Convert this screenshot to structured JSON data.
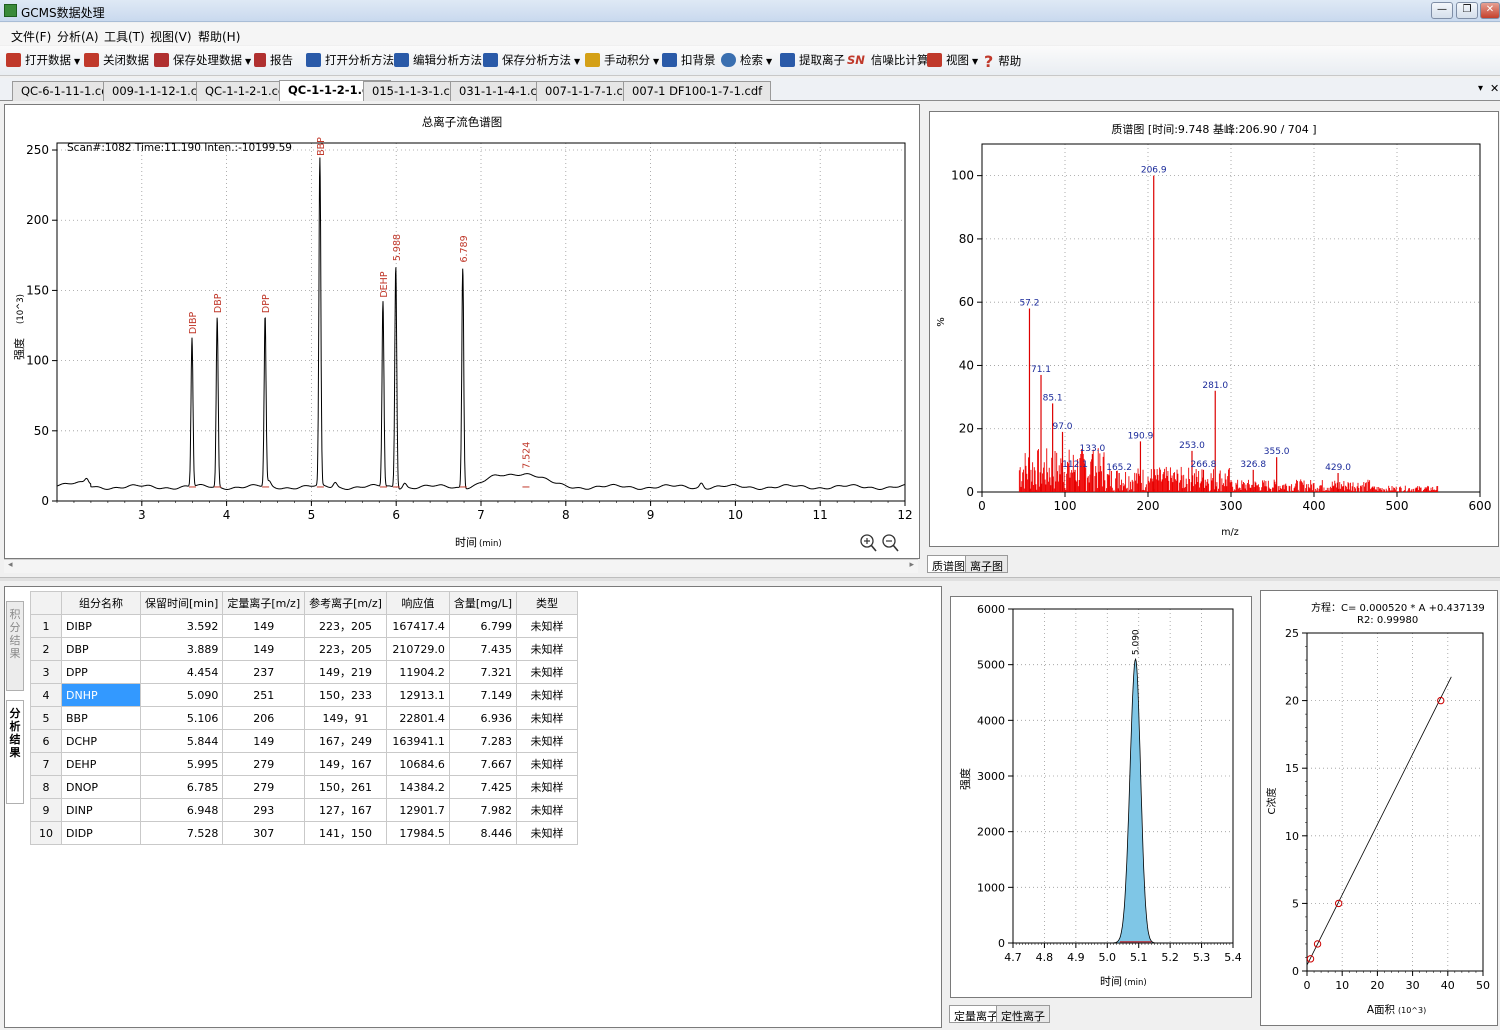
{
  "window": {
    "title": "GCMS数据处理",
    "minimize": "▭",
    "restore": "▭",
    "close": "✕"
  },
  "menu": [
    "文件(F)",
    "分析(A)",
    "工具(T)",
    "视图(V)",
    "帮助(H)"
  ],
  "toolbar": [
    {
      "label": "打开数据",
      "icon": "open-folder-icon",
      "color": "#c0392b",
      "dropdown": true
    },
    {
      "label": "关闭数据",
      "icon": "close-data-icon",
      "color": "#c0392b",
      "dropdown": false
    },
    {
      "label": "保存处理数据",
      "icon": "save-icon",
      "color": "#b03030",
      "dropdown": true
    },
    {
      "label": "报告",
      "icon": "report-icon",
      "color": "#b03030",
      "dropdown": false
    },
    {
      "label": "打开分析方法",
      "icon": "open-method-icon",
      "color": "#2a5aa8",
      "dropdown": false
    },
    {
      "label": "编辑分析方法",
      "icon": "edit-method-icon",
      "color": "#2a5aa8",
      "dropdown": false
    },
    {
      "label": "保存分析方法",
      "icon": "save-method-icon",
      "color": "#2a5aa8",
      "dropdown": true
    },
    {
      "label": "手动积分",
      "icon": "manual-integration-icon",
      "color": "#d4a017",
      "dropdown": true
    },
    {
      "label": "扣背景",
      "icon": "subtract-background-icon",
      "color": "#2a5aa8",
      "dropdown": false
    },
    {
      "label": "检索",
      "icon": "search-icon",
      "color": "#3a6fb0",
      "dropdown": true
    },
    {
      "label": "提取离子",
      "icon": "extract-ion-icon",
      "color": "#2a5aa8",
      "dropdown": false
    },
    {
      "label": "信噪比计算",
      "icon": "sn-icon",
      "color": "#c0392b",
      "dropdown": false,
      "prefix": "SN"
    },
    {
      "label": "视图",
      "icon": "view-grid-icon",
      "color": "#c0392b",
      "dropdown": true
    },
    {
      "label": "帮助",
      "icon": "help-icon",
      "color": "#c0392b",
      "dropdown": false,
      "prefix": "?"
    }
  ],
  "tabs": [
    {
      "label": "QC-6-1-11-1.cdf",
      "active": false
    },
    {
      "label": "009-1-1-12-1.cdf",
      "active": false
    },
    {
      "label": "QC-1-1-2-1.cdf",
      "active": false
    },
    {
      "label": "QC-1-1-2-1.cdf",
      "active": true
    },
    {
      "label": "015-1-1-3-1.cdf",
      "active": false
    },
    {
      "label": "031-1-1-4-1.cdf",
      "active": false
    },
    {
      "label": "007-1-1-7-1.cdf",
      "active": false
    },
    {
      "label": "007-1 DF100-1-7-1.cdf",
      "active": false
    }
  ],
  "tab_controls": {
    "dropdown": "▾",
    "close": "✕"
  },
  "tic": {
    "title": "总离子流色谱图",
    "scan_info": "Scan#:1082  Time:11.190  Inten.:-10199.59",
    "xlabel": "时间",
    "xunit": "(min)",
    "ylabel": "强度",
    "yunit": "(10^3)",
    "zoom_in": "zoom-in-icon",
    "zoom_out": "zoom-out-icon"
  },
  "mass_spectrum": {
    "title": "质谱图 [时间:9.748 基峰:206.90 / 704 ]",
    "ylabel": "%",
    "xlabel": "m/z"
  },
  "spectrum_tabs": [
    {
      "label": "质谱图",
      "active": true
    },
    {
      "label": "离子图",
      "active": false
    }
  ],
  "side_tabs": [
    {
      "label": "积分结果",
      "active": false
    },
    {
      "label": "分析结果",
      "active": true
    }
  ],
  "results_table": {
    "headers": [
      "",
      "组分名称",
      "保留时间[min]",
      "定量离子[m/z]",
      "参考离子[m/z]",
      "响应值",
      "含量[mg/L]",
      "类型"
    ],
    "rows": [
      [
        "1",
        "DIBP",
        "3.592",
        "149",
        "223，205",
        "167417.4",
        "6.799",
        "未知样"
      ],
      [
        "2",
        "DBP",
        "3.889",
        "149",
        "223，205",
        "210729.0",
        "7.435",
        "未知样"
      ],
      [
        "3",
        "DPP",
        "4.454",
        "237",
        "149，219",
        "11904.2",
        "7.321",
        "未知样"
      ],
      [
        "4",
        "DNHP",
        "5.090",
        "251",
        "150，233",
        "12913.1",
        "7.149",
        "未知样"
      ],
      [
        "5",
        "BBP",
        "5.106",
        "206",
        "149，91",
        "22801.4",
        "6.936",
        "未知样"
      ],
      [
        "6",
        "DCHP",
        "5.844",
        "149",
        "167，249",
        "163941.1",
        "7.283",
        "未知样"
      ],
      [
        "7",
        "DEHP",
        "5.995",
        "279",
        "149，167",
        "10684.6",
        "7.667",
        "未知样"
      ],
      [
        "8",
        "DNOP",
        "6.785",
        "279",
        "150，261",
        "14384.2",
        "7.425",
        "未知样"
      ],
      [
        "9",
        "DINP",
        "6.948",
        "293",
        "127，167",
        "12901.7",
        "7.982",
        "未知样"
      ],
      [
        "10",
        "DIDP",
        "7.528",
        "307",
        "141，150",
        "17984.5",
        "8.446",
        "未知样"
      ]
    ],
    "selected_row": 3
  },
  "peak_plot": {
    "ylabel": "强度",
    "xlabel": "时间",
    "xunit": "(min)"
  },
  "ion_tabs": [
    {
      "label": "定量离子",
      "active": true
    },
    {
      "label": "定性离子",
      "active": false
    }
  ],
  "calibration": {
    "equation": "方程：C= 0.000520 * A +0.437139",
    "r2": "R2:  0.99980",
    "ylabel": "C浓度",
    "xlabel": "A面积",
    "xunit": "(10^3)"
  },
  "chart_data": [
    {
      "type": "line",
      "name": "tic-chromatogram",
      "xlim": [
        2.0,
        12.0
      ],
      "ylim": [
        0,
        255
      ],
      "xticks": [
        3,
        4,
        5,
        6,
        7,
        8,
        9,
        10,
        11,
        12
      ],
      "yticks": [
        0,
        50,
        100,
        150,
        200,
        250
      ],
      "baseline": 10,
      "peaks": [
        {
          "x": 3.592,
          "y": 116,
          "label": "DIBP"
        },
        {
          "x": 3.889,
          "y": 131,
          "label": "DBP"
        },
        {
          "x": 4.454,
          "y": 131,
          "label": "DPP"
        },
        {
          "x": 5.1,
          "y": 243,
          "label": "BBP"
        },
        {
          "x": 5.844,
          "y": 142,
          "label": "DEHP"
        },
        {
          "x": 5.995,
          "y": 168,
          "label": "5.988"
        },
        {
          "x": 6.785,
          "y": 167,
          "label": "6.789"
        },
        {
          "x": 7.524,
          "y": 20,
          "label": "7.524"
        }
      ],
      "grid": true
    },
    {
      "type": "bar",
      "name": "mass-spectrum",
      "xlim": [
        0,
        600
      ],
      "ylim": [
        0,
        110
      ],
      "xticks": [
        0,
        100,
        200,
        300,
        400,
        500,
        600
      ],
      "yticks": [
        0,
        20,
        40,
        60,
        80,
        100
      ],
      "labeled_peaks": [
        {
          "mz": 57.2,
          "rel": 58
        },
        {
          "mz": 71.1,
          "rel": 37
        },
        {
          "mz": 85.1,
          "rel": 28
        },
        {
          "mz": 97.0,
          "rel": 19
        },
        {
          "mz": 112.1,
          "rel": 7
        },
        {
          "mz": 133.0,
          "rel": 12
        },
        {
          "mz": 165.2,
          "rel": 6
        },
        {
          "mz": 190.9,
          "rel": 16
        },
        {
          "mz": 206.9,
          "rel": 100
        },
        {
          "mz": 253.0,
          "rel": 13
        },
        {
          "mz": 266.8,
          "rel": 7
        },
        {
          "mz": 281.0,
          "rel": 32
        },
        {
          "mz": 326.8,
          "rel": 7
        },
        {
          "mz": 355.0,
          "rel": 11
        },
        {
          "mz": 429.0,
          "rel": 6
        }
      ],
      "grid": true
    },
    {
      "type": "area",
      "name": "quant-ion-peak",
      "xlim": [
        4.7,
        5.4
      ],
      "ylim": [
        0,
        6000
      ],
      "xticks": [
        4.7,
        4.8,
        4.9,
        5.0,
        5.1,
        5.2,
        5.3,
        5.4
      ],
      "yticks": [
        0,
        1000,
        2000,
        3000,
        4000,
        5000,
        6000
      ],
      "peak": {
        "x": 5.09,
        "y": 5100,
        "width": 0.025,
        "label": "5.090"
      },
      "grid": true
    },
    {
      "type": "scatter",
      "name": "calibration-curve",
      "xlim": [
        0,
        50
      ],
      "ylim": [
        0,
        25
      ],
      "xticks": [
        0,
        10,
        20,
        30,
        40,
        50
      ],
      "yticks": [
        0,
        5,
        10,
        15,
        20,
        25
      ],
      "points": [
        {
          "x": 1,
          "y": 0.9
        },
        {
          "x": 3,
          "y": 2.0
        },
        {
          "x": 9,
          "y": 5.0
        },
        {
          "x": 38,
          "y": 20.0
        }
      ],
      "line": {
        "slope": 0.52,
        "intercept": 0.437139,
        "x0": 0,
        "x1": 41
      },
      "grid": true
    }
  ]
}
